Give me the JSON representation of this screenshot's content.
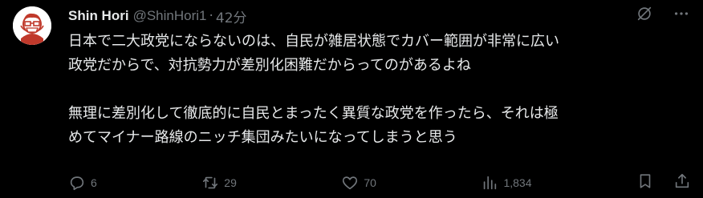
{
  "tweet": {
    "display_name": "Shin Hori",
    "handle": "@ShinHori1",
    "separator": "·",
    "time": "42分",
    "paragraph1": "日本で二大政党にならないのは、自民が雑居状態でカバー範囲が非常に広い\n政党だからで、対抗勢力が差別化困難だからってのがあるよね",
    "paragraph2": "無理に差別化して徹底的に自民とまったく異質な政党を作ったら、それは極\nめてマイナー路線のニッチ集団みたいになってしまうと思う"
  },
  "actions": {
    "replies": "6",
    "reposts": "29",
    "likes": "70",
    "views": "1,834"
  },
  "icons": [
    "grok-icon",
    "more-icon",
    "reply-icon",
    "repost-icon",
    "like-icon",
    "views-icon",
    "bookmark-icon",
    "share-icon"
  ],
  "colors": {
    "background": "#000000",
    "text": "#e7e9ea",
    "muted": "#71767b",
    "avatar_accent": "#c0392b"
  }
}
